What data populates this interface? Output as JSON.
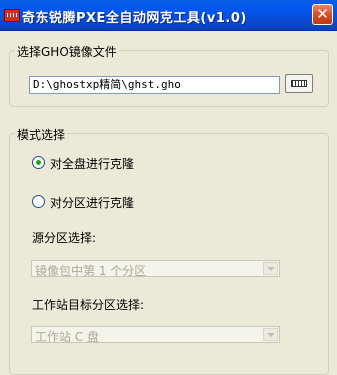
{
  "window": {
    "title": "奇东锐腾PXE全自动网克工具(v1.0)"
  },
  "ghost_group": {
    "legend": "选择GHO镜像文件",
    "path_value": "D:\\ghostxp精简\\ghst.gho"
  },
  "mode_group": {
    "legend": "模式选择",
    "option_full_disk": "对全盘进行克隆",
    "option_partition": "对分区进行克隆",
    "selected": "full_disk",
    "source_label": "源分区选择:",
    "source_value": "镜像包中第 1 个分区",
    "target_label": "工作站目标分区选择:",
    "target_value": "工作站 C 盘"
  },
  "icons": {
    "app": "app-icon",
    "close": "close-icon",
    "browse": "browse-icon",
    "dropdown": "chevron-down-icon"
  },
  "colors": {
    "titlebar": "#0058ee",
    "close": "#d3471f",
    "background": "#ece9d8",
    "disabled_text": "#aca899"
  }
}
